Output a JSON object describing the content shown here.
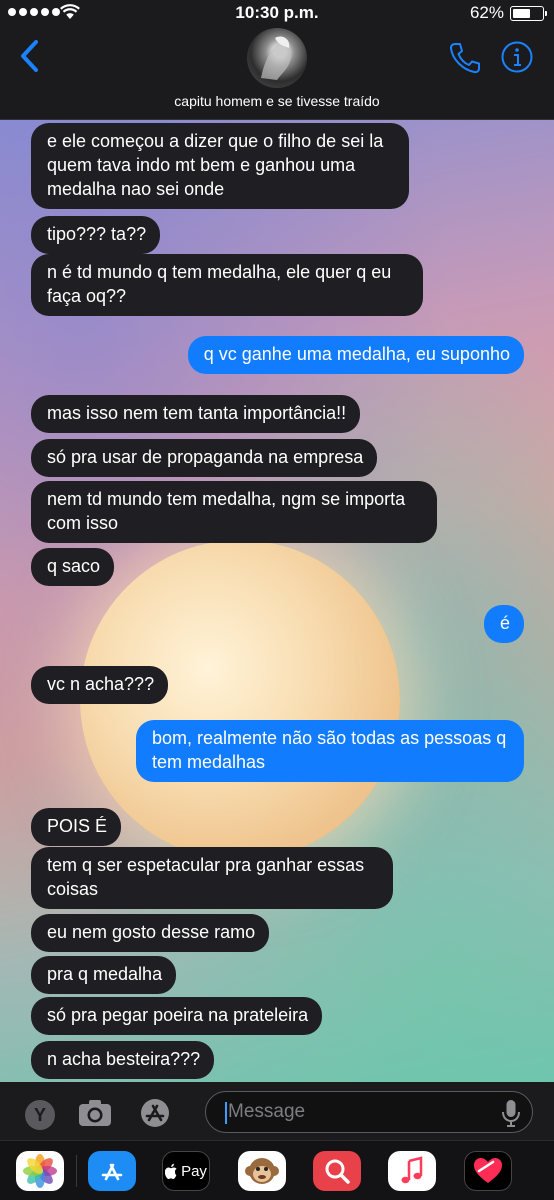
{
  "status_bar": {
    "time": "10:30 p.m.",
    "battery_percent": "62%",
    "battery_level": 0.62,
    "signal_dots": 5
  },
  "header": {
    "contact_name": "capitu homem e se tivesse traído",
    "accent_color": "#1a82ff"
  },
  "messages": [
    {
      "dir": "in",
      "text": "e ele começou a dizer que o filho de sei la quem tava indo mt bem e ganhou uma medalha nao sei onde"
    },
    {
      "dir": "in",
      "text": "tipo??? ta??"
    },
    {
      "dir": "in",
      "text": "n é td mundo q tem medalha, ele quer q eu faça oq??"
    },
    {
      "dir": "out",
      "text": "q vc ganhe uma medalha, eu suponho"
    },
    {
      "dir": "in",
      "text": "mas isso nem tem tanta importância!!"
    },
    {
      "dir": "in",
      "text": "só pra usar de propaganda na empresa"
    },
    {
      "dir": "in",
      "text": "nem td mundo tem medalha, ngm se importa com isso"
    },
    {
      "dir": "in",
      "text": "q saco"
    },
    {
      "dir": "out",
      "text": "é"
    },
    {
      "dir": "in",
      "text": "vc n acha???"
    },
    {
      "dir": "out",
      "text": "bom, realmente não são todas as pessoas q tem medalhas"
    },
    {
      "dir": "in",
      "text": "POIS É"
    },
    {
      "dir": "in",
      "text": "tem q ser espetacular pra ganhar essas coisas"
    },
    {
      "dir": "in",
      "text": "eu nem gosto desse ramo"
    },
    {
      "dir": "in",
      "text": "pra q medalha"
    },
    {
      "dir": "in",
      "text": "só pra pegar poeira na prateleira"
    },
    {
      "dir": "in",
      "text": "n acha besteira???"
    }
  ],
  "input_bar": {
    "shortcut_letter": "Y",
    "placeholder": "Message"
  },
  "app_drawer": {
    "apple_pay_label": "Pay",
    "apps": [
      "photos-icon",
      "app-store-icon",
      "apple-pay-icon",
      "animoji-icon",
      "search-images-icon",
      "music-icon",
      "digital-touch-icon"
    ]
  }
}
